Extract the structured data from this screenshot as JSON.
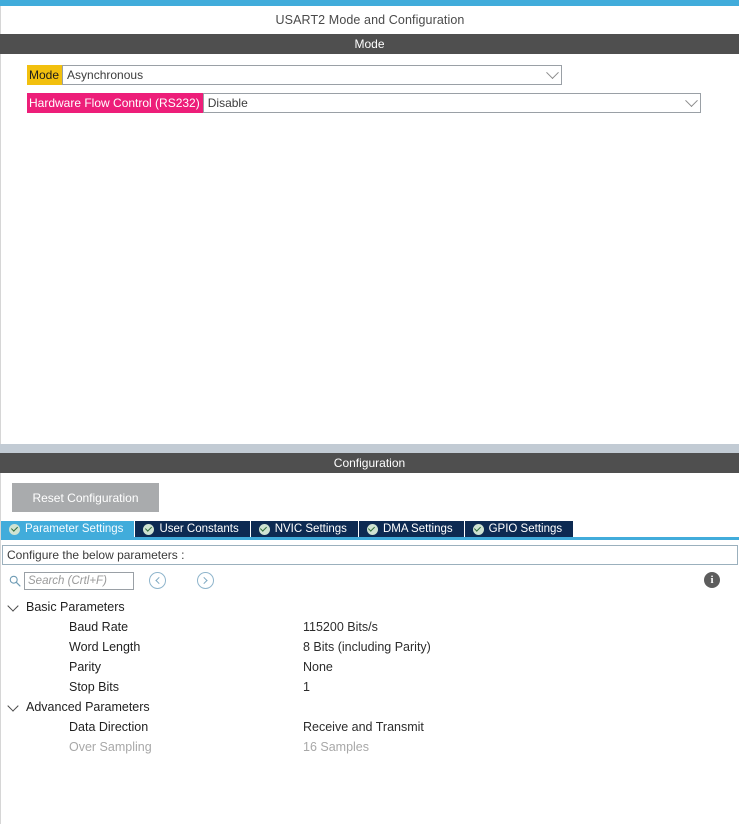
{
  "window": {
    "title": "USART2 Mode and Configuration",
    "accent_color": "#41acdb"
  },
  "mode_panel": {
    "header": "Mode",
    "fields": [
      {
        "label": "Mode",
        "label_highlight": "#f2c00e",
        "value": "Asynchronous",
        "caret_icon": "chevron-down-icon"
      },
      {
        "label": "Hardware Flow Control (RS232)",
        "label_highlight": "#ed1e79",
        "value": "Disable",
        "caret_icon": "chevron-down-icon"
      }
    ]
  },
  "configuration_panel": {
    "header": "Configuration",
    "reset_button": "Reset Configuration",
    "tabs": [
      {
        "label": "Parameter Settings",
        "active": true,
        "icon": "check-circle-icon"
      },
      {
        "label": "User Constants",
        "active": false,
        "icon": "check-circle-icon"
      },
      {
        "label": "NVIC Settings",
        "active": false,
        "icon": "check-circle-icon"
      },
      {
        "label": "DMA Settings",
        "active": false,
        "icon": "check-circle-icon"
      },
      {
        "label": "GPIO Settings",
        "active": false,
        "icon": "check-circle-icon"
      }
    ],
    "tab_active_color": "#41acdb",
    "tab_inactive_color": "#0d2a52",
    "configure_hint": "Configure the below parameters :",
    "search": {
      "placeholder": "Search (Crtl+F)",
      "value": "",
      "icon": "search-icon",
      "prev_icon": "chevron-left-circle-icon",
      "next_icon": "chevron-right-circle-icon"
    },
    "info_icon": "info-icon",
    "info_glyph": "i",
    "parameter_groups": [
      {
        "name": "Basic Parameters",
        "expanded": true,
        "parameters": [
          {
            "name": "Baud Rate",
            "value": "115200 Bits/s",
            "disabled": false
          },
          {
            "name": "Word Length",
            "value": "8 Bits (including Parity)",
            "disabled": false
          },
          {
            "name": "Parity",
            "value": "None",
            "disabled": false
          },
          {
            "name": "Stop Bits",
            "value": "1",
            "disabled": false
          }
        ]
      },
      {
        "name": "Advanced Parameters",
        "expanded": true,
        "parameters": [
          {
            "name": "Data Direction",
            "value": "Receive and Transmit",
            "disabled": false
          },
          {
            "name": "Over Sampling",
            "value": "16 Samples",
            "disabled": true
          }
        ]
      }
    ]
  }
}
